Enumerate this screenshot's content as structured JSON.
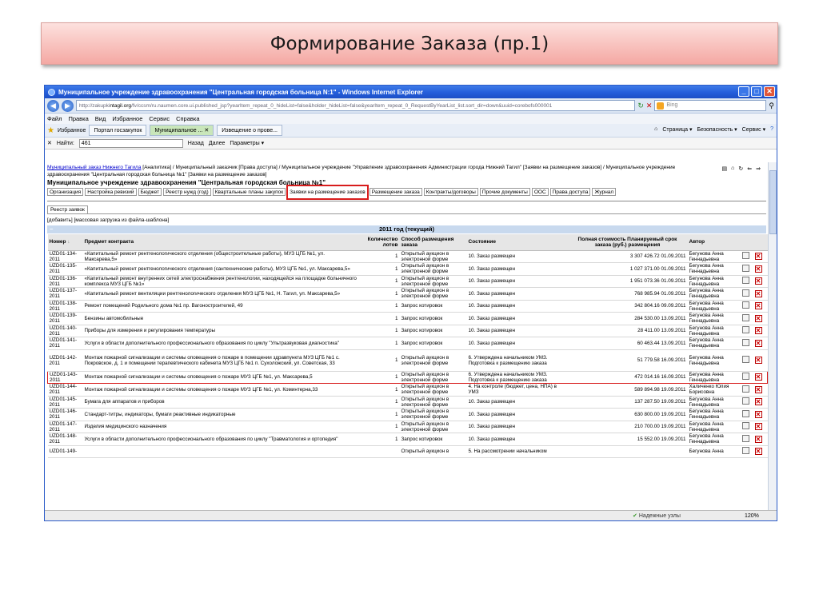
{
  "slide": {
    "title": "Формирование Заказа (пр.1)"
  },
  "window": {
    "title": "Муниципальное учреждение здравоохранения \"Центральная городская больница N:1\" - Windows Internet Explorer"
  },
  "address": {
    "url_prefix": "http://zakupki",
    "url_host": "ntagil.org",
    "url_rest": "/fv/ccsm/ru.naumen.core.ui.published_jsp?yearItem_repeat_0_hideList=false&holder_hideList=false&yearItem_repeat_0_RequestByYearList_list.sort_dir=down&uuid=corebofs000001",
    "search_placeholder": "Bing"
  },
  "menu": [
    "Файл",
    "Правка",
    "Вид",
    "Избранное",
    "Сервис",
    "Справка"
  ],
  "favorites": {
    "label": "Избранное",
    "tabs": [
      "Портал госзакупок",
      "Муниципальное ...",
      "Извещение о прове..."
    ],
    "tools": [
      "Страница ▾",
      "Безопасность ▾",
      "Сервис ▾"
    ]
  },
  "find": {
    "label": "Найти:",
    "value": "461",
    "back": "Назад",
    "next": "Далее",
    "params": "Параметры ▾"
  },
  "breadcrumb": {
    "root": "Муниципальный заказ Нижнего Тагила",
    "rest": " [Аналитика] / Муниципальный заказчик [Права доступа] / Муниципальное учреждение \"Управление здравоохранения Администрации города Нижний Тагил\" [Заявки на размещение заказов] / Муниципальное учреждение здравоохранения \"Центральная городская больница №1\" [Заявки на размещение заказов]",
    "org_title": "Муниципальное учреждение здравоохранения \"Центральная городская больница №1\""
  },
  "tabs": [
    "Организация",
    "Настройка ревизий",
    "Бюджет",
    "Реестр нужд (год)",
    "Квартальные планы закупок",
    "Заявки на размещение заказов",
    "Размещение заказа",
    "Контракты/договоры",
    "Прочие документы",
    "ООС",
    "Права доступа",
    "Журнал"
  ],
  "subtab": "Реестр заявок",
  "actions": "[добавить] [массовая загрузка из файла-шаблона]",
  "year": "2011 год (текущий)",
  "year_toggle": "−",
  "table": {
    "headers": [
      "Номер",
      "Предмет контракта",
      "Количество лотов",
      "Способ размещения заказа",
      "Состояние",
      "Полная стоимость Планируемый срок заказа (руб.) размещения",
      "Автор"
    ],
    "sort_arrow": "↓",
    "rows": [
      {
        "num": "UZD01-134-2011",
        "subject": "«Капитальный ремонт рентгенологического отделения (общестроительные работы), МУЗ ЦГБ №1, ул. Максарева,5»",
        "lots": "1",
        "method": "Открытый аукцион в электронной форме",
        "state": "10. Заказ размещен",
        "cost": "3 307 426.72 01.09.2011",
        "author": "Бегунова Анна Геннадьевна"
      },
      {
        "num": "UZD01-135-2011",
        "subject": "«Капитальный ремонт рентгенологического отделения (сантехнические работы), МУЗ ЦГБ №1, ул. Максарева,5»",
        "lots": "1",
        "method": "Открытый аукцион в электронной форме",
        "state": "10. Заказ размещен",
        "cost": "1 027 371.00 01.09.2011",
        "author": "Бегунова Анна Геннадьевна"
      },
      {
        "num": "UZD01-136-2011",
        "subject": "«Капитальный ремонт внутренних сетей электроснабжения рентгенологии, находящейся на площадке больничного комплекса МУЗ ЦГБ №1»",
        "lots": "1",
        "method": "Открытый аукцион в электронной форме",
        "state": "10. Заказ размещен",
        "cost": "1 951 073.36 01.09.2011",
        "author": "Бегунова Анна Геннадьевна"
      },
      {
        "num": "UZD01-137-2011",
        "subject": "«Капитальный ремонт вентиляции рентгенологического отделения МУЗ ЦГБ №1, Н. Тагил, ул. Максарева,5»",
        "lots": "1",
        "method": "Открытый аукцион в электронной форме",
        "state": "10. Заказ размещен",
        "cost": "768 985.94 01.09.2011",
        "author": "Бегунова Анна Геннадьевна"
      },
      {
        "num": "UZD01-138-2011",
        "subject": "Ремонт помещений Родильного дома №1 пр. Вагоностроителей, 49",
        "lots": "1",
        "method": "Запрос котировок",
        "state": "10. Заказ размещен",
        "cost": "342 804.16 09.09.2011",
        "author": "Бегунова Анна Геннадьевна"
      },
      {
        "num": "UZD01-139-2011",
        "subject": "Бензины автомобильные",
        "lots": "1",
        "method": "Запрос котировок",
        "state": "10. Заказ размещен",
        "cost": "284 530.00 13.09.2011",
        "author": "Бегунова Анна Геннадьевна"
      },
      {
        "num": "UZD01-140-2011",
        "subject": "Приборы для измерения и регулирования температуры",
        "lots": "1",
        "method": "Запрос котировок",
        "state": "10. Заказ размещен",
        "cost": "28 411.00 13.09.2011",
        "author": "Бегунова Анна Геннадьевна"
      },
      {
        "num": "UZD01-141-2011",
        "subject": "Услуги в области дополнительного профессионального образования по циклу \"Ультразвуковая диагностика\"",
        "lots": "1",
        "method": "Запрос котировок",
        "state": "10. Заказ размещен",
        "cost": "60 463.44 13.09.2011",
        "author": "Бегунова Анна Геннадьевна"
      },
      {
        "num": "UZD01-142-2011",
        "subject": "Монтаж пожарной сигнализации и системы оповещения о пожаре в помещении здравпункта МУЗ ЦГБ №1 с. Покровское, д. 1 и помещении терапевтического кабинета МУЗ ЦГБ №1 п. Сухоложский, ул. Советская, 33",
        "lots": "1",
        "method": "Открытый аукцион в электронной форме",
        "state": "6. Утверждена начальником УМЗ. Подготовка к размещению заказа",
        "cost": "51 779.58 16.09.2011",
        "author": "Бегунова Анна Геннадьевна"
      },
      {
        "num": "UZD01-143-2011",
        "subject": "Монтаж пожарной сигнализации и системы оповещения о пожаре МУЗ ЦГБ №1, ул. Максарева,5",
        "lots": "1",
        "method": "Открытый аукцион в электронной форме",
        "state": "6. Утверждена начальником УМЗ. Подготовка к размещению заказа",
        "cost": "472 014.16 16.09.2011",
        "author": "Бегунова Анна Геннадьевна"
      },
      {
        "num": "UZD01-144-2011",
        "subject": "Монтаж пожарной сигнализации и системы оповещения о пожаре МУЗ ЦГБ №1, ул. Коминтерна,33",
        "lots": "1",
        "method": "Открытый аукцион в электронной форме",
        "state": "4. На контроле (бюджет, цена, НПА) в УМЗ",
        "cost": "589 894.98 19.09.2011",
        "author": "Халиченко Юлия Борисовна"
      },
      {
        "num": "UZD01-145-2011",
        "subject": "Бумага для аппаратов и приборов",
        "lots": "1",
        "method": "Открытый аукцион в электронной форме",
        "state": "10. Заказ размещен",
        "cost": "137 287.50 19.09.2011",
        "author": "Бегунова Анна Геннадьевна"
      },
      {
        "num": "UZD01-146-2011",
        "subject": "Стандарт-титры, индикаторы, бумаги реактивные индикаторные",
        "lots": "1",
        "method": "Открытый аукцион в электронной форме",
        "state": "10. Заказ размещен",
        "cost": "630 800.00 19.09.2011",
        "author": "Бегунова Анна Геннадьевна"
      },
      {
        "num": "UZD01-147-2011",
        "subject": "Изделия медицинского назначения",
        "lots": "1",
        "method": "Открытый аукцион в электронной форме",
        "state": "10. Заказ размещен",
        "cost": "210 700.00 19.09.2011",
        "author": "Бегунова Анна Геннадьевна"
      },
      {
        "num": "UZD01-148-2011",
        "subject": "Услуги в области дополнительного профессионального образования по циклу \"Травматология и ортопедия\"",
        "lots": "1",
        "method": "Запрос котировок",
        "state": "10. Заказ размещен",
        "cost": "15 552.00 19.09.2011",
        "author": "Бегунова Анна Геннадьевна"
      },
      {
        "num": "UZD01-149-",
        "subject": "",
        "lots": "",
        "method": "Открытый аукцион в",
        "state": "5. На рассмотрении начальником",
        "cost": "",
        "author": "Бегунова Анна"
      }
    ]
  },
  "status": {
    "zone": "Надежные узлы",
    "zoom": "120%"
  }
}
